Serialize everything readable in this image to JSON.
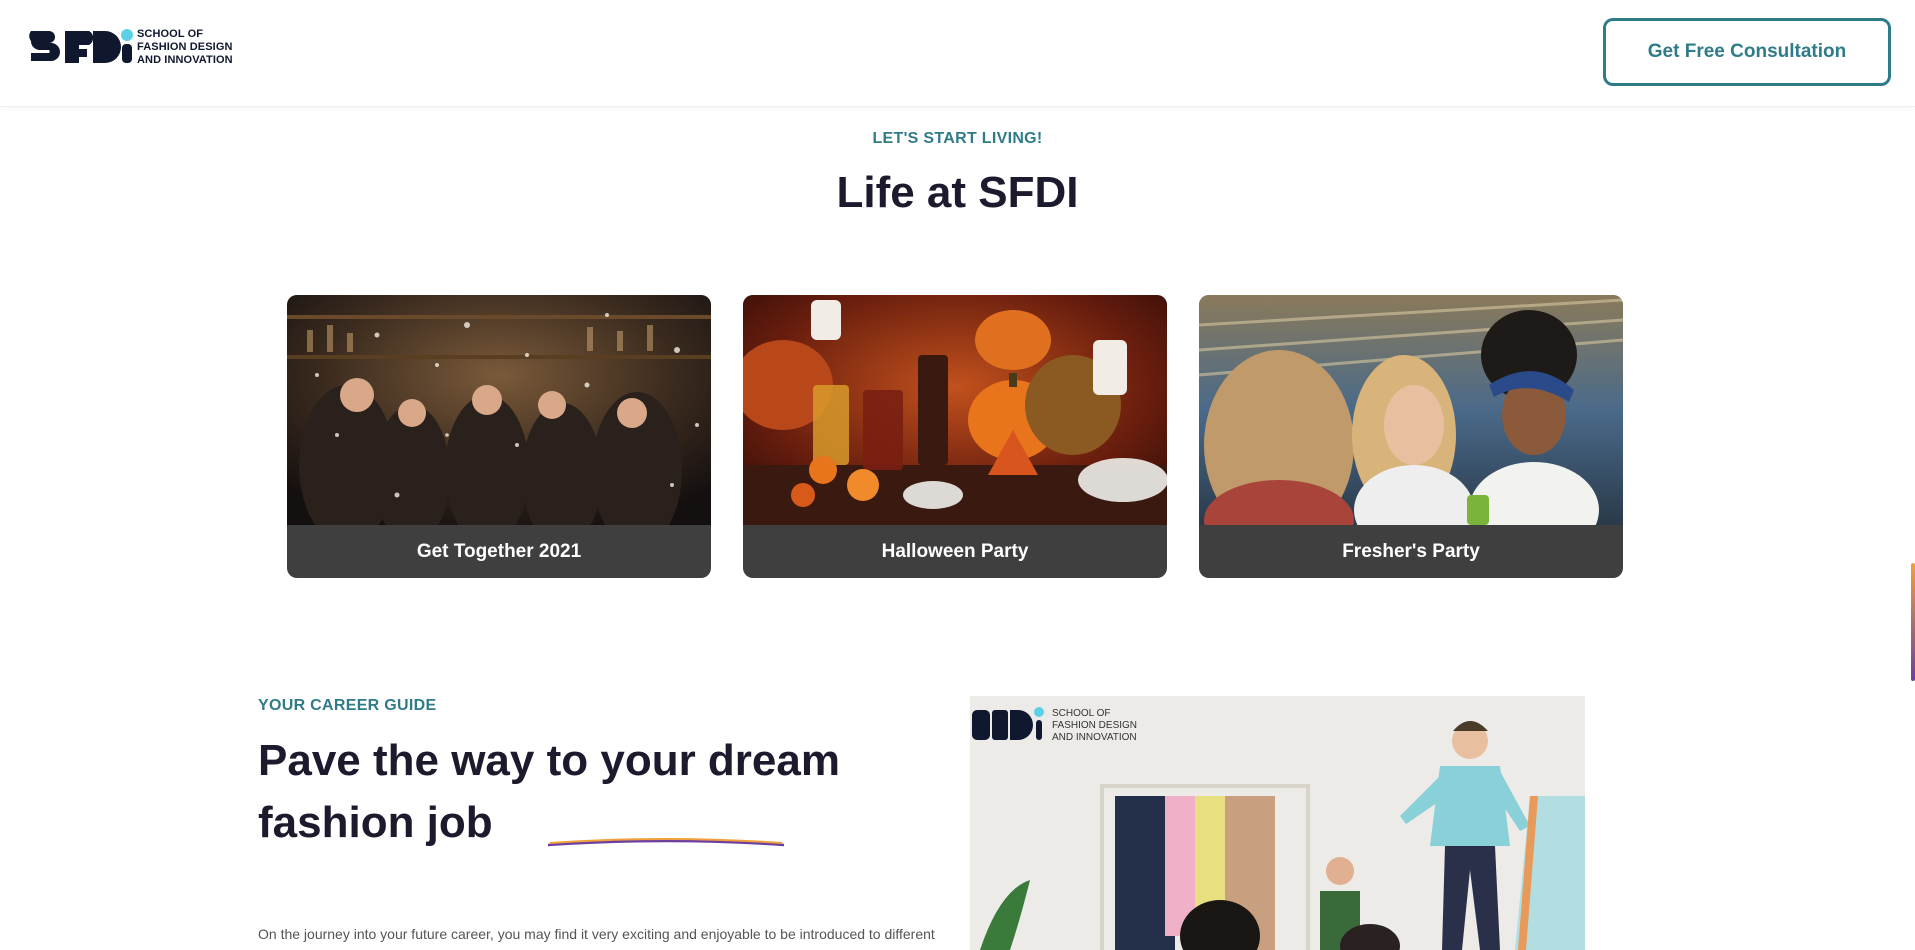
{
  "header": {
    "logo_wordmark": "SFDi",
    "logo_line1": "SCHOOL OF",
    "logo_line2": "FASHION DESIGN",
    "logo_line3": "AND INNOVATION",
    "cta_label": "Get Free Consultation"
  },
  "life": {
    "eyebrow": "LET'S START LIVING!",
    "title": "Life at SFDI",
    "cards": [
      {
        "caption": "Get Together 2021",
        "image": "party-confetti-photo"
      },
      {
        "caption": "Halloween Party",
        "image": "halloween-table-photo"
      },
      {
        "caption": "Fresher's Party",
        "image": "friends-laughing-photo"
      }
    ]
  },
  "career": {
    "eyebrow": "YOUR CAREER GUIDE",
    "title_line1": "Pave the way to your dream",
    "title_line2": "fashion job",
    "body": "On the journey into your future career, you may find it very exciting and enjoyable to be introduced to different",
    "image": "sfdi-mural-photo",
    "mural_logo_line1": "SCHOOL OF",
    "mural_logo_line2": "FASHION DESIGN",
    "mural_logo_line3": "AND INNOVATION"
  },
  "colors": {
    "accent": "#2f7c88",
    "heading": "#1c1b2e",
    "caption_bg": "#3f3f3f",
    "logo_dot": "#5ad1e6"
  }
}
